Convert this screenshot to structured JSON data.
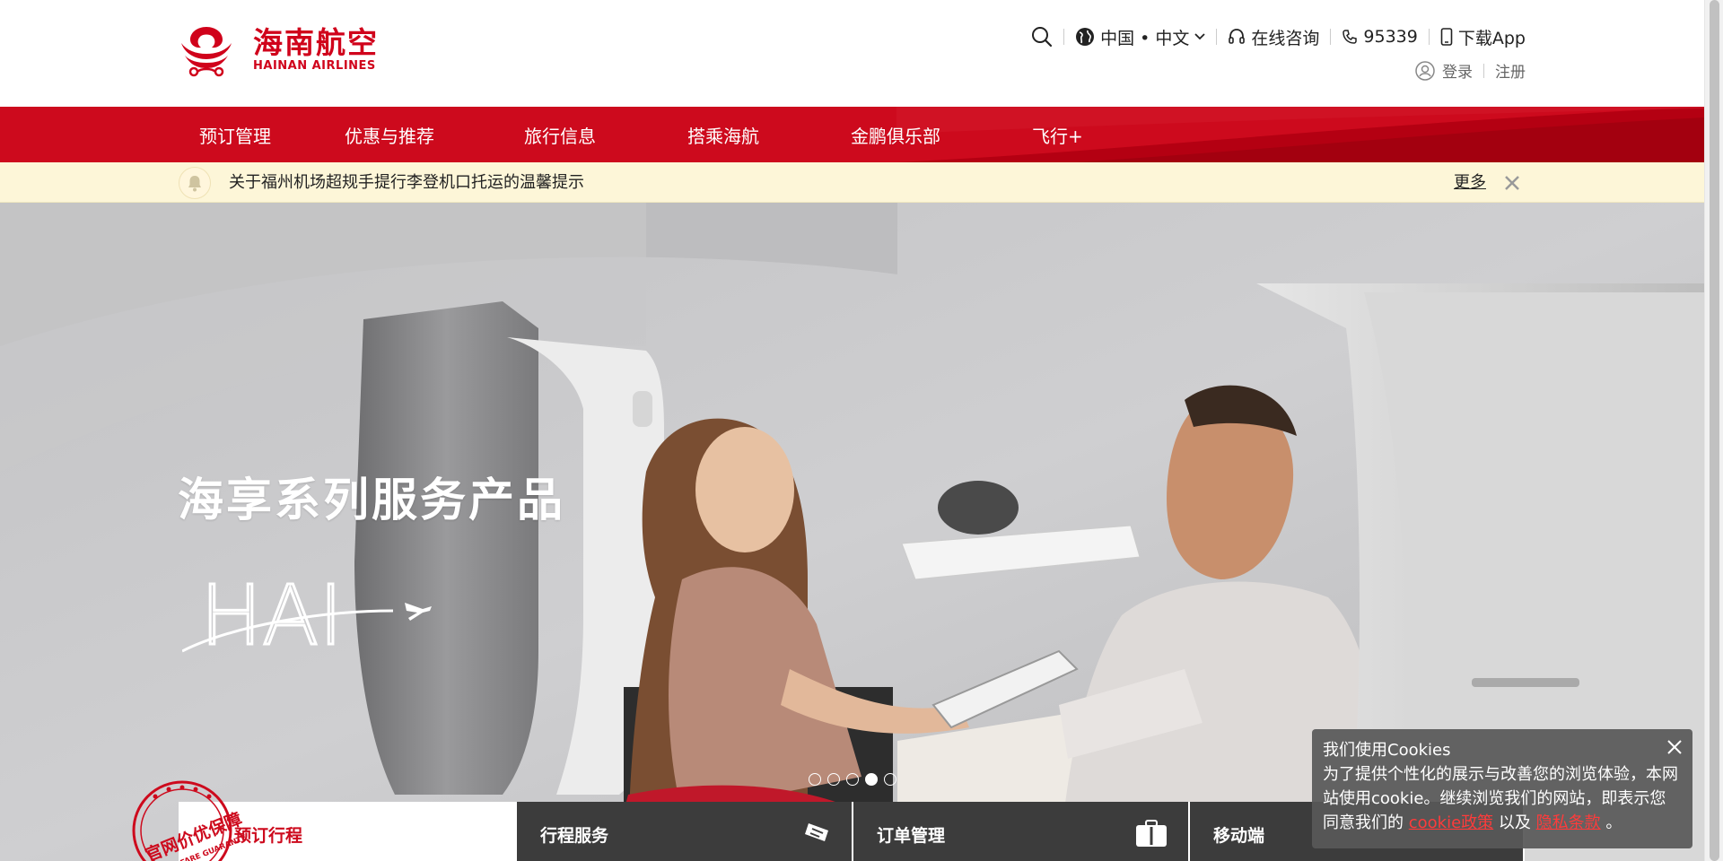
{
  "brand": {
    "name_cn": "海南航空",
    "name_en": "HAINAN AIRLINES",
    "color": "#cd0a1d"
  },
  "header": {
    "search_icon": "search-icon",
    "language": "中国 • 中文",
    "consult": "在线咨询",
    "phone": "95339",
    "download_app": "下载App",
    "login": "登录",
    "register": "注册"
  },
  "nav": {
    "items": [
      {
        "label": "预订管理"
      },
      {
        "label": "优惠与推荐"
      },
      {
        "label": "旅行信息"
      },
      {
        "label": "搭乘海航"
      },
      {
        "label": "金鹏俱乐部"
      },
      {
        "label": "飞行+"
      }
    ]
  },
  "notice": {
    "text": "关于福州机场超规手提行李登机口托运的温馨提示",
    "more": "更多"
  },
  "hero": {
    "title": "海享系列服务产品",
    "logo_text": "HAI",
    "slides_count": 5,
    "active_slide": 4
  },
  "booking": {
    "stamp_text_1": "官网价优保障",
    "stamp_text_2": "LOW FARE GUARANTEE",
    "tabs": [
      {
        "label": "预订行程"
      },
      {
        "label": "行程服务"
      },
      {
        "label": "订单管理"
      },
      {
        "label": "移动端"
      }
    ]
  },
  "cookie": {
    "title": "我们使用Cookies",
    "body": "为了提供个性化的展示与改善您的浏览体验，本网站使用cookie。继续浏览我们的网站，即表示您同意我们的",
    "policy_link": "cookie政策",
    "and": "以及",
    "privacy_link": "隐私条款",
    "end": "。"
  }
}
